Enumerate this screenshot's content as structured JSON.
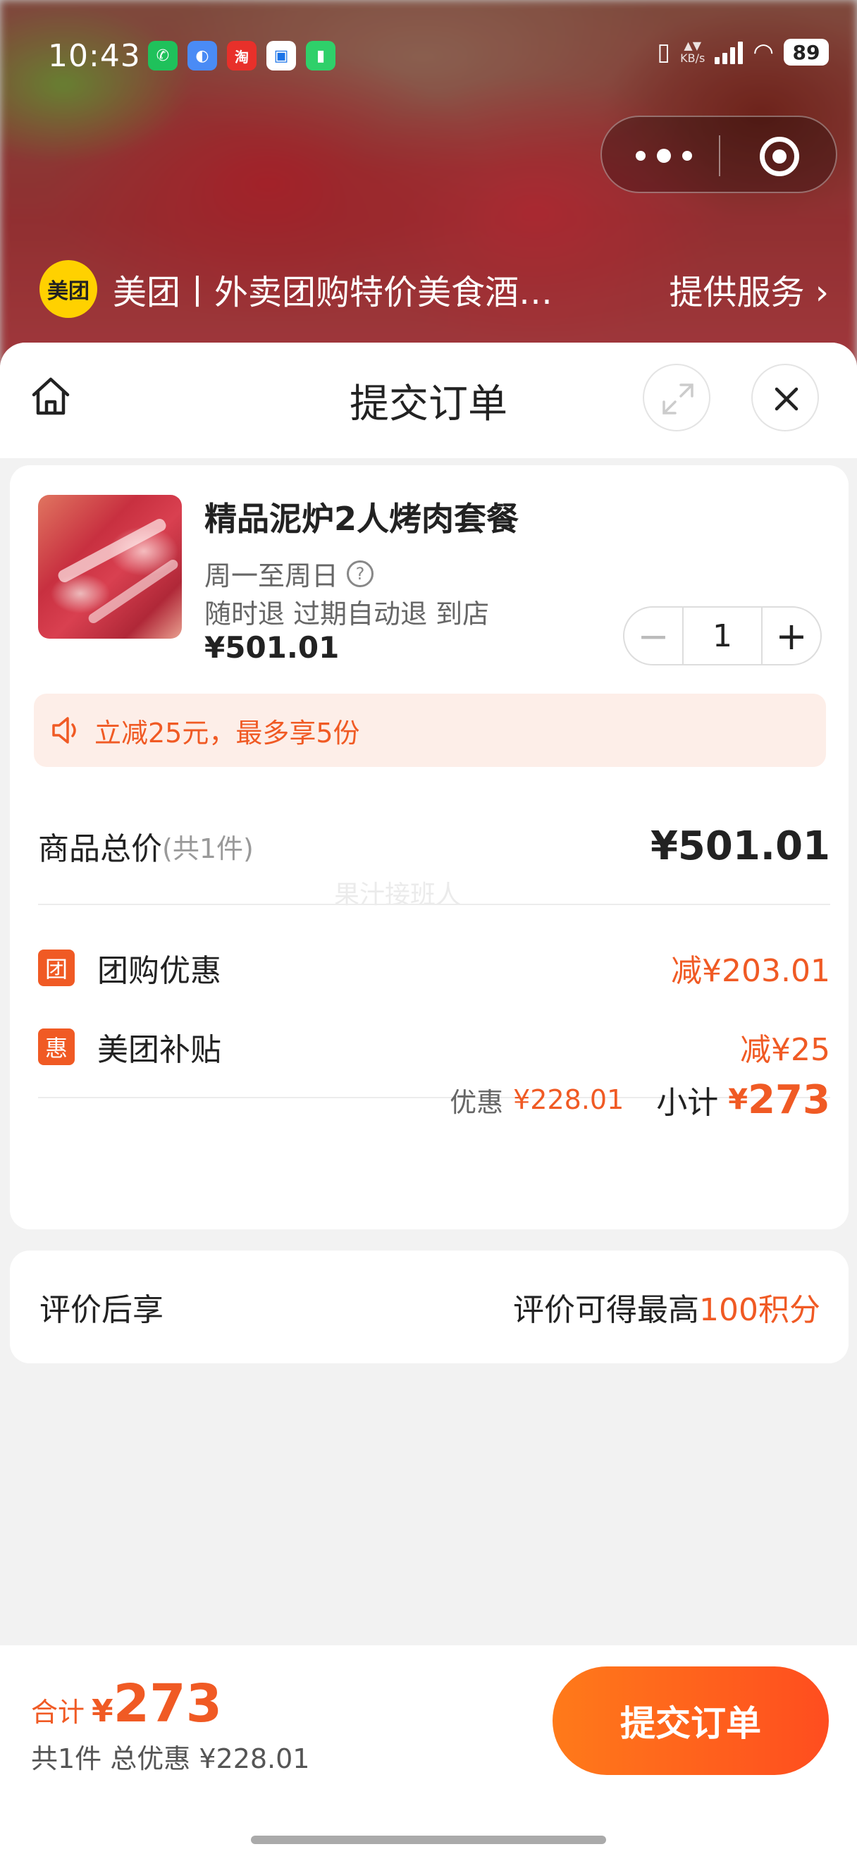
{
  "status_bar": {
    "time": "10:43",
    "battery": "89",
    "app_icons": [
      {
        "name": "wechat-icon",
        "color": "#1fc15b",
        "glyph": "✆"
      },
      {
        "name": "alipay-icon",
        "color": "#4a8bf5",
        "glyph": "◐"
      },
      {
        "name": "taobao-icon",
        "color": "#e8302a",
        "glyph": "淘"
      },
      {
        "name": "app-icon",
        "color": "#ffffff",
        "glyph": "▣"
      },
      {
        "name": "green-app-icon",
        "color": "#2fd06a",
        "glyph": "▮"
      }
    ]
  },
  "provider": {
    "logo_text": "美团",
    "name": "美团丨外卖团购特价美食酒…",
    "service_label": "提供服务"
  },
  "header": {
    "title": "提交订单"
  },
  "product": {
    "name": "精品泥炉2人烤肉套餐",
    "validity": "周一至周日",
    "tags": "随时退 过期自动退 到店",
    "price": "¥501.01",
    "quantity": "1"
  },
  "promo": {
    "text": "立减25元，最多享5份"
  },
  "summary": {
    "total_label": "商品总价",
    "total_count": "(共1件)",
    "total_value": "¥501.01",
    "watermark": "果汁接班人",
    "discounts": [
      {
        "badge": "团",
        "label": "团购优惠",
        "value": "减¥203.01"
      },
      {
        "badge": "惠",
        "label": "美团补贴",
        "value": "减¥25"
      }
    ],
    "sub_discount_label": "优惠",
    "sub_discount_value": "¥228.01",
    "subtotal_label": "小计",
    "subtotal_yen": "¥",
    "subtotal_value": "273"
  },
  "review": {
    "left": "评价后享",
    "right_prefix": "评价可得最高",
    "right_points": "100积分"
  },
  "bottom_bar": {
    "sum_label": "合计",
    "sum_yen": "¥",
    "sum_value": "273",
    "detail": "共1件 总优惠 ¥228.01",
    "submit_label": "提交订单"
  },
  "colors": {
    "accent": "#f05a24",
    "button_start": "#ff7a1a",
    "button_end": "#ff4d1f",
    "brand_yellow": "#ffd100"
  }
}
